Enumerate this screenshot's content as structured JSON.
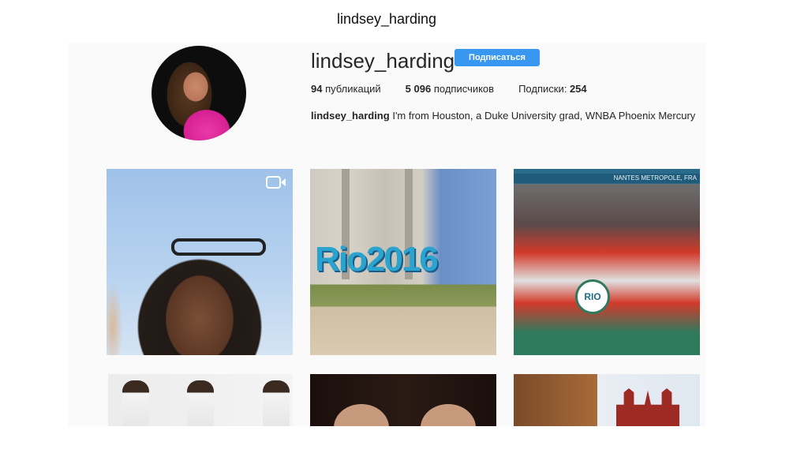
{
  "slide": {
    "title": "lindsey_harding"
  },
  "profile": {
    "username": "lindsey_harding",
    "follow_label": "Подписаться",
    "stats": {
      "posts_value": "94",
      "posts_label": "публикаций",
      "followers_value": "5 096",
      "followers_label": "подписчиков",
      "following_label": "Подписки:",
      "following_value": "254"
    },
    "bio_name": "lindsey_harding",
    "bio_text": "I'm from Houston, a Duke University grad, WNBA Phoenix Mercury"
  },
  "posts": {
    "t2_sign": "Rio2016",
    "t3_banner": "NANTES METROPOLE, FRA",
    "t3_logo": "RIO"
  },
  "colors": {
    "accent": "#3897f0",
    "background": "#fafafa",
    "text": "#262626"
  },
  "icons": {
    "video": "video-camera-icon"
  }
}
